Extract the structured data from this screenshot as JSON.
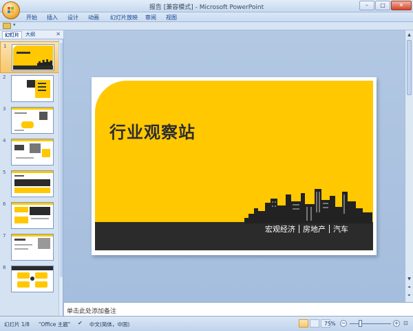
{
  "window": {
    "title": "报告 [兼容模式] - Microsoft PowerPoint",
    "minimize_label": "–",
    "maximize_label": "□",
    "close_label": "✕"
  },
  "ribbon": {
    "tabs": [
      "开始",
      "插入",
      "设计",
      "动画",
      "幻灯片放映",
      "审阅",
      "视图"
    ]
  },
  "qat": {
    "dropdown": "▾"
  },
  "slides_panel": {
    "tabs": [
      "幻灯片",
      "大纲"
    ],
    "active_tab": "幻灯片",
    "close_label": "✕",
    "slide_numbers": [
      "1",
      "2",
      "3",
      "4",
      "5",
      "6",
      "7",
      "8"
    ],
    "selected": 1
  },
  "slide": {
    "title": "行业观察站",
    "tags": [
      "宏观经济",
      "房地产",
      "汽车"
    ],
    "colors": {
      "accent": "#ffc800",
      "band": "#2b2b2b",
      "title": "#2d2d2d"
    }
  },
  "notes": {
    "placeholder": "单击此处添加备注"
  },
  "status_bar": {
    "slide_info": "幻灯片 1/8",
    "theme": "\"Office 主题\"",
    "language": "中文(简体，中国)",
    "zoom": "75%",
    "zoom_out": "−",
    "zoom_in": "+"
  },
  "icons": [
    "office-button",
    "folder-icon",
    "spellcheck-icon",
    "fit-window-icon"
  ]
}
